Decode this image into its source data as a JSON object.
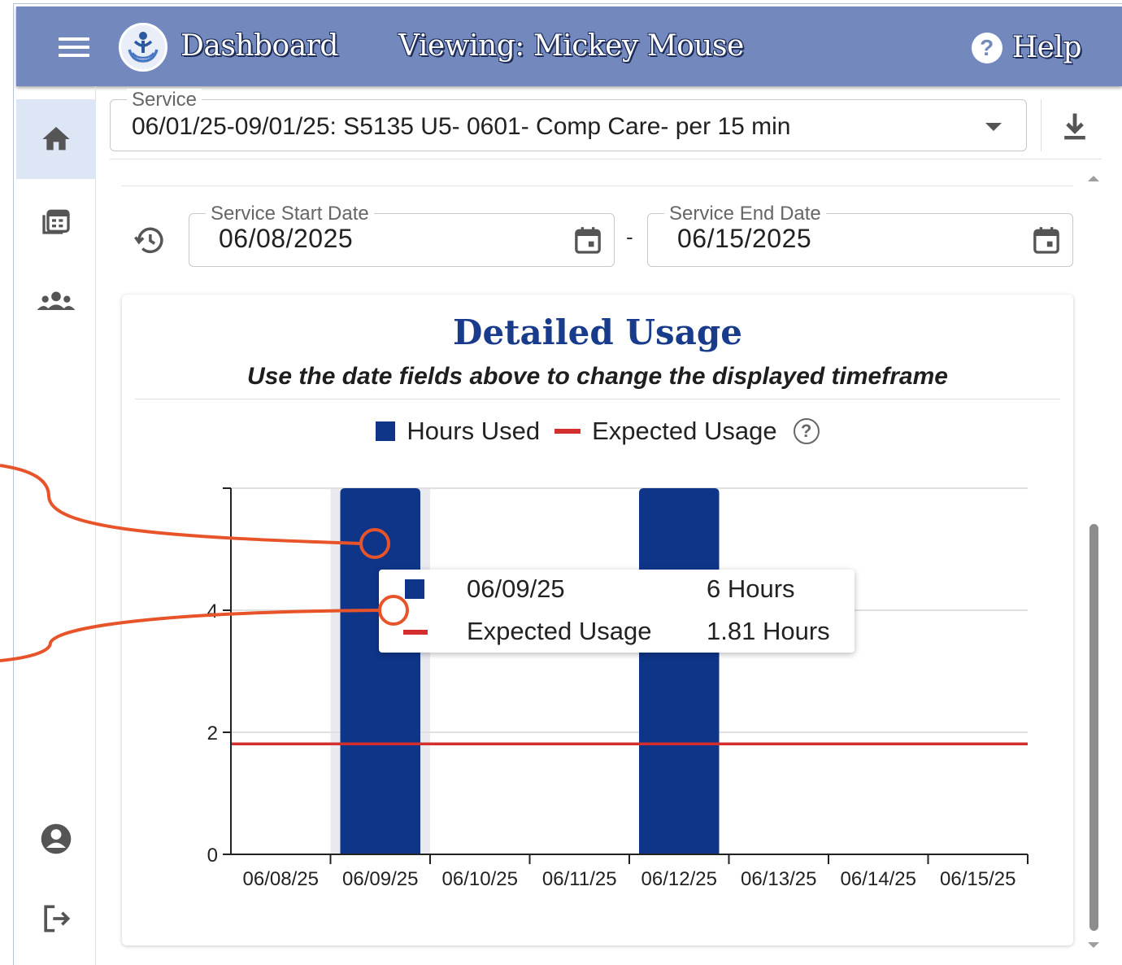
{
  "header": {
    "title": "Dashboard",
    "viewing": "Viewing: Mickey Mouse",
    "help_label": "Help",
    "help_icon": "?"
  },
  "sidebar": {
    "items": [
      {
        "icon": "home-icon",
        "active": true
      },
      {
        "icon": "calendar-grid-icon",
        "active": false
      },
      {
        "icon": "group-icon",
        "active": false
      },
      {
        "icon": "account-icon",
        "active": false
      },
      {
        "icon": "logout-icon",
        "active": false
      }
    ]
  },
  "service": {
    "label": "Service",
    "value": "06/01/25-09/01/25: S5135 U5- 0601- Comp Care- per 15 min"
  },
  "dates": {
    "start_label": "Service Start Date",
    "start_value": "06/08/2025",
    "separator": "-",
    "end_label": "Service End Date",
    "end_value": "06/15/2025"
  },
  "card": {
    "title": "Detailed Usage",
    "subtitle": "Use the date fields above to change the displayed timeframe"
  },
  "legend": {
    "hours_used": "Hours Used",
    "expected_usage": "Expected Usage",
    "info_icon": "?"
  },
  "colors": {
    "bar": "#0f3589",
    "expected_line": "#d32f2f",
    "header": "#7389bd",
    "callout": "#e8542a"
  },
  "chart_data": {
    "type": "bar",
    "categories": [
      "06/08/25",
      "06/09/25",
      "06/10/25",
      "06/11/25",
      "06/12/25",
      "06/13/25",
      "06/14/25",
      "06/15/25"
    ],
    "series": [
      {
        "name": "Hours Used",
        "values": [
          0,
          6,
          0,
          0,
          6,
          0,
          0,
          0
        ]
      },
      {
        "name": "Expected Usage",
        "type": "line",
        "values": [
          1.81,
          1.81,
          1.81,
          1.81,
          1.81,
          1.81,
          1.81,
          1.81
        ]
      }
    ],
    "y_ticks": [
      "0",
      "2",
      "4"
    ],
    "ylim": [
      0,
      6
    ],
    "grid": true,
    "legend_position": "top-center",
    "highlighted_category": "06/09/25"
  },
  "tooltip": {
    "date": "06/09/25",
    "date_value": "6 Hours",
    "expected_label": "Expected Usage",
    "expected_value": "1.81 Hours"
  }
}
